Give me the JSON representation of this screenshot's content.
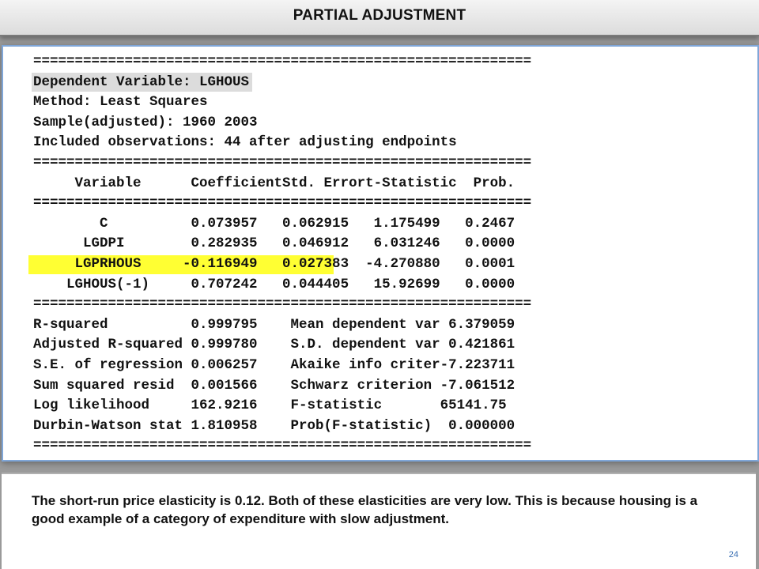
{
  "slide": {
    "title": "PARTIAL ADJUSTMENT",
    "page_number": "24",
    "highlight_colors": {
      "dependent_variable": "#dcdcdc",
      "price_row": "#ffff33"
    }
  },
  "regression": {
    "separator": "============================================================",
    "dependent_variable": "Dependent Variable: LGHOUS",
    "method": "Method: Least Squares",
    "sample": "Sample(adjusted): 1960 2003",
    "observations": "Included observations: 44 after adjusting endpoints",
    "header": "     Variable      CoefficientStd. Errort-Statistic  Prob.",
    "rows": [
      "        C          0.073957   0.062915   1.175499   0.2467",
      "      LGDPI        0.282935   0.046912   6.031246   0.0000",
      "     LGPRHOUS     -0.116949   0.027383  -4.270880   0.0001",
      "    LGHOUS(-1)     0.707242   0.044405   15.92699   0.0000"
    ],
    "stats": [
      "R-squared          0.999795    Mean dependent var 6.379059",
      "Adjusted R-squared 0.999780    S.D. dependent var 0.421861",
      "S.E. of regression 0.006257    Akaike info criter-7.223711",
      "Sum squared resid  0.001566    Schwarz criterion -7.061512",
      "Log likelihood     162.9216    F-statistic       65141.75",
      "Durbin-Watson stat 1.810958    Prob(F-statistic)  0.000000"
    ]
  },
  "note": {
    "text": "The short-run price elasticity is 0.12.  Both of these elasticities are very low.  This is because housing is a good example of a category of expenditure with slow adjustment."
  }
}
